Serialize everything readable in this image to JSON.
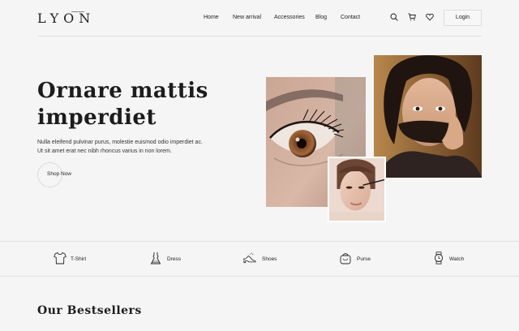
{
  "header": {
    "logo": "LYON",
    "nav": [
      "Home",
      "New arrival",
      "Accessories",
      "Blog",
      "Contact"
    ],
    "icons": [
      "search-icon",
      "cart-icon",
      "heart-icon"
    ],
    "login_label": "Login"
  },
  "hero": {
    "title_line1": "Ornare mattis",
    "title_line2": "imperdiet",
    "text_line1": "Nulla eleifend pulvinar purus, molestie euismod odio imperdiet ac.",
    "text_line2": "Ut sit amet erat nec nibh rhoncus varius in non lorem.",
    "cta_label": "Shop Now"
  },
  "categories": [
    {
      "label": "T-Shirt",
      "icon": "tshirt-icon"
    },
    {
      "label": "Dress",
      "icon": "dress-icon"
    },
    {
      "label": "Shoes",
      "icon": "shoe-icon"
    },
    {
      "label": "Purse",
      "icon": "purse-icon"
    },
    {
      "label": "Watch",
      "icon": "watch-icon"
    }
  ],
  "bestsellers": {
    "title": "Our Bestsellers"
  },
  "colors": {
    "background": "#f5f5f5",
    "text": "#222222",
    "divider": "#e2e2e2"
  }
}
